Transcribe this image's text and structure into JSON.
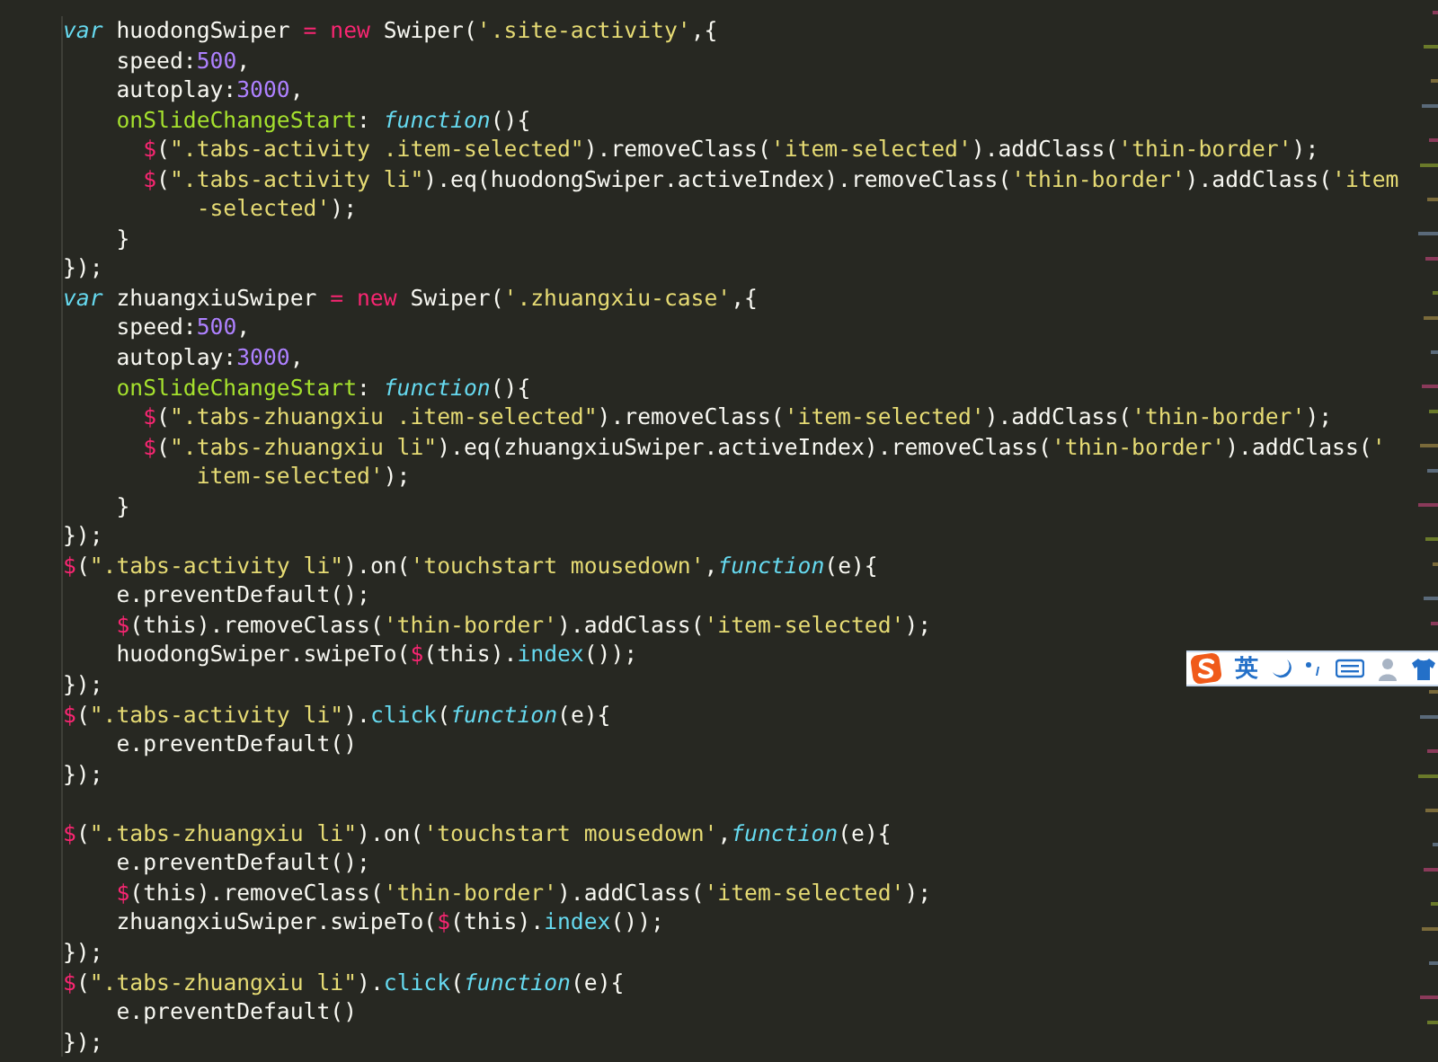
{
  "editor": {
    "lines": [
      {
        "tokens": [
          {
            "kind": "storage",
            "text": "var"
          },
          {
            "kind": "plain",
            "text": " huodongSwiper "
          },
          {
            "kind": "operator",
            "text": "= new"
          },
          {
            "kind": "plain",
            "text": " Swiper("
          },
          {
            "kind": "string",
            "text": "'.site-activity'"
          },
          {
            "kind": "plain",
            "text": ",{"
          }
        ]
      },
      {
        "tokens": [
          {
            "kind": "plain",
            "text": "    speed:"
          },
          {
            "kind": "number",
            "text": "500"
          },
          {
            "kind": "plain",
            "text": ","
          }
        ]
      },
      {
        "tokens": [
          {
            "kind": "plain",
            "text": "    autoplay:"
          },
          {
            "kind": "number",
            "text": "3000"
          },
          {
            "kind": "plain",
            "text": ","
          }
        ]
      },
      {
        "tokens": [
          {
            "kind": "property",
            "text": "    onSlideChangeStart"
          },
          {
            "kind": "plain",
            "text": ": "
          },
          {
            "kind": "storage",
            "text": "function"
          },
          {
            "kind": "plain",
            "text": "(){"
          }
        ]
      },
      {
        "tokens": [
          {
            "kind": "operator",
            "text": "      $"
          },
          {
            "kind": "plain",
            "text": "("
          },
          {
            "kind": "string",
            "text": "\".tabs-activity .item-selected\""
          },
          {
            "kind": "plain",
            "text": ").removeClass("
          },
          {
            "kind": "string",
            "text": "'item-selected'"
          },
          {
            "kind": "plain",
            "text": ").addClass("
          },
          {
            "kind": "string",
            "text": "'thin-border'"
          },
          {
            "kind": "plain",
            "text": ");"
          }
        ]
      },
      {
        "tokens": [
          {
            "kind": "operator",
            "text": "      $"
          },
          {
            "kind": "plain",
            "text": "("
          },
          {
            "kind": "string",
            "text": "\".tabs-activity li\""
          },
          {
            "kind": "plain",
            "text": ").eq(huodongSwiper.activeIndex).removeClass("
          },
          {
            "kind": "string",
            "text": "'thin-border'"
          },
          {
            "kind": "plain",
            "text": ").addClass("
          },
          {
            "kind": "string",
            "text": "'item"
          }
        ]
      },
      {
        "tokens": [
          {
            "kind": "string",
            "text": "          -selected'"
          },
          {
            "kind": "plain",
            "text": ");"
          }
        ]
      },
      {
        "tokens": [
          {
            "kind": "plain",
            "text": "    }"
          }
        ]
      },
      {
        "tokens": [
          {
            "kind": "plain",
            "text": "});"
          }
        ]
      },
      {
        "tokens": [
          {
            "kind": "storage",
            "text": "var"
          },
          {
            "kind": "plain",
            "text": " zhuangxiuSwiper "
          },
          {
            "kind": "operator",
            "text": "= new"
          },
          {
            "kind": "plain",
            "text": " Swiper("
          },
          {
            "kind": "string",
            "text": "'.zhuangxiu-case'"
          },
          {
            "kind": "plain",
            "text": ",{"
          }
        ]
      },
      {
        "tokens": [
          {
            "kind": "plain",
            "text": "    speed:"
          },
          {
            "kind": "number",
            "text": "500"
          },
          {
            "kind": "plain",
            "text": ","
          }
        ]
      },
      {
        "tokens": [
          {
            "kind": "plain",
            "text": "    autoplay:"
          },
          {
            "kind": "number",
            "text": "3000"
          },
          {
            "kind": "plain",
            "text": ","
          }
        ]
      },
      {
        "tokens": [
          {
            "kind": "property",
            "text": "    onSlideChangeStart"
          },
          {
            "kind": "plain",
            "text": ": "
          },
          {
            "kind": "storage",
            "text": "function"
          },
          {
            "kind": "plain",
            "text": "(){"
          }
        ]
      },
      {
        "tokens": [
          {
            "kind": "operator",
            "text": "      $"
          },
          {
            "kind": "plain",
            "text": "("
          },
          {
            "kind": "string",
            "text": "\".tabs-zhuangxiu .item-selected\""
          },
          {
            "kind": "plain",
            "text": ").removeClass("
          },
          {
            "kind": "string",
            "text": "'item-selected'"
          },
          {
            "kind": "plain",
            "text": ").addClass("
          },
          {
            "kind": "string",
            "text": "'thin-border'"
          },
          {
            "kind": "plain",
            "text": ");"
          }
        ]
      },
      {
        "tokens": [
          {
            "kind": "operator",
            "text": "      $"
          },
          {
            "kind": "plain",
            "text": "("
          },
          {
            "kind": "string",
            "text": "\".tabs-zhuangxiu li\""
          },
          {
            "kind": "plain",
            "text": ").eq(zhuangxiuSwiper.activeIndex).removeClass("
          },
          {
            "kind": "string",
            "text": "'thin-border'"
          },
          {
            "kind": "plain",
            "text": ").addClass("
          },
          {
            "kind": "string",
            "text": "'"
          }
        ]
      },
      {
        "tokens": [
          {
            "kind": "string",
            "text": "          item-selected'"
          },
          {
            "kind": "plain",
            "text": ");"
          }
        ]
      },
      {
        "tokens": [
          {
            "kind": "plain",
            "text": "    }"
          }
        ]
      },
      {
        "tokens": [
          {
            "kind": "plain",
            "text": "});"
          }
        ]
      },
      {
        "tokens": [
          {
            "kind": "operator",
            "text": "$"
          },
          {
            "kind": "plain",
            "text": "("
          },
          {
            "kind": "string",
            "text": "\".tabs-activity li\""
          },
          {
            "kind": "plain",
            "text": ").on("
          },
          {
            "kind": "string",
            "text": "'touchstart mousedown'"
          },
          {
            "kind": "plain",
            "text": ","
          },
          {
            "kind": "storage",
            "text": "function"
          },
          {
            "kind": "plain",
            "text": "(e){"
          }
        ]
      },
      {
        "tokens": [
          {
            "kind": "plain",
            "text": "    e.preventDefault();"
          }
        ]
      },
      {
        "tokens": [
          {
            "kind": "operator",
            "text": "    $"
          },
          {
            "kind": "plain",
            "text": "(this).removeClass("
          },
          {
            "kind": "string",
            "text": "'thin-border'"
          },
          {
            "kind": "plain",
            "text": ").addClass("
          },
          {
            "kind": "string",
            "text": "'item-selected'"
          },
          {
            "kind": "plain",
            "text": ");"
          }
        ]
      },
      {
        "tokens": [
          {
            "kind": "plain",
            "text": "    huodongSwiper.swipeTo("
          },
          {
            "kind": "operator",
            "text": "$"
          },
          {
            "kind": "plain",
            "text": "(this)."
          },
          {
            "kind": "method",
            "text": "index"
          },
          {
            "kind": "plain",
            "text": "());"
          }
        ]
      },
      {
        "tokens": [
          {
            "kind": "plain",
            "text": "});"
          }
        ]
      },
      {
        "tokens": [
          {
            "kind": "operator",
            "text": "$"
          },
          {
            "kind": "plain",
            "text": "("
          },
          {
            "kind": "string",
            "text": "\".tabs-activity li\""
          },
          {
            "kind": "plain",
            "text": ")."
          },
          {
            "kind": "method",
            "text": "click"
          },
          {
            "kind": "plain",
            "text": "("
          },
          {
            "kind": "storage",
            "text": "function"
          },
          {
            "kind": "plain",
            "text": "(e){"
          }
        ]
      },
      {
        "tokens": [
          {
            "kind": "plain",
            "text": "    e.preventDefault()"
          }
        ]
      },
      {
        "tokens": [
          {
            "kind": "plain",
            "text": "});"
          }
        ]
      },
      {
        "kind": "blank"
      },
      {
        "tokens": [
          {
            "kind": "operator",
            "text": "$"
          },
          {
            "kind": "plain",
            "text": "("
          },
          {
            "kind": "string",
            "text": "\".tabs-zhuangxiu li\""
          },
          {
            "kind": "plain",
            "text": ").on("
          },
          {
            "kind": "string",
            "text": "'touchstart mousedown'"
          },
          {
            "kind": "plain",
            "text": ","
          },
          {
            "kind": "storage",
            "text": "function"
          },
          {
            "kind": "plain",
            "text": "(e){"
          }
        ]
      },
      {
        "tokens": [
          {
            "kind": "plain",
            "text": "    e.preventDefault();"
          }
        ]
      },
      {
        "tokens": [
          {
            "kind": "operator",
            "text": "    $"
          },
          {
            "kind": "plain",
            "text": "(this).removeClass("
          },
          {
            "kind": "string",
            "text": "'thin-border'"
          },
          {
            "kind": "plain",
            "text": ").addClass("
          },
          {
            "kind": "string",
            "text": "'item-selected'"
          },
          {
            "kind": "plain",
            "text": ");"
          }
        ]
      },
      {
        "tokens": [
          {
            "kind": "plain",
            "text": "    zhuangxiuSwiper.swipeTo("
          },
          {
            "kind": "operator",
            "text": "$"
          },
          {
            "kind": "plain",
            "text": "(this)."
          },
          {
            "kind": "method",
            "text": "index"
          },
          {
            "kind": "plain",
            "text": "());"
          }
        ]
      },
      {
        "tokens": [
          {
            "kind": "plain",
            "text": "});"
          }
        ]
      },
      {
        "tokens": [
          {
            "kind": "operator",
            "text": "$"
          },
          {
            "kind": "plain",
            "text": "("
          },
          {
            "kind": "string",
            "text": "\".tabs-zhuangxiu li\""
          },
          {
            "kind": "plain",
            "text": ")."
          },
          {
            "kind": "method",
            "text": "click"
          },
          {
            "kind": "plain",
            "text": "("
          },
          {
            "kind": "storage",
            "text": "function"
          },
          {
            "kind": "plain",
            "text": "(e){"
          }
        ]
      },
      {
        "tokens": [
          {
            "kind": "plain",
            "text": "    e.preventDefault()"
          }
        ]
      },
      {
        "tokens": [
          {
            "kind": "plain",
            "text": "});"
          }
        ]
      }
    ]
  },
  "ime_toolbar": {
    "mode": "英"
  }
}
